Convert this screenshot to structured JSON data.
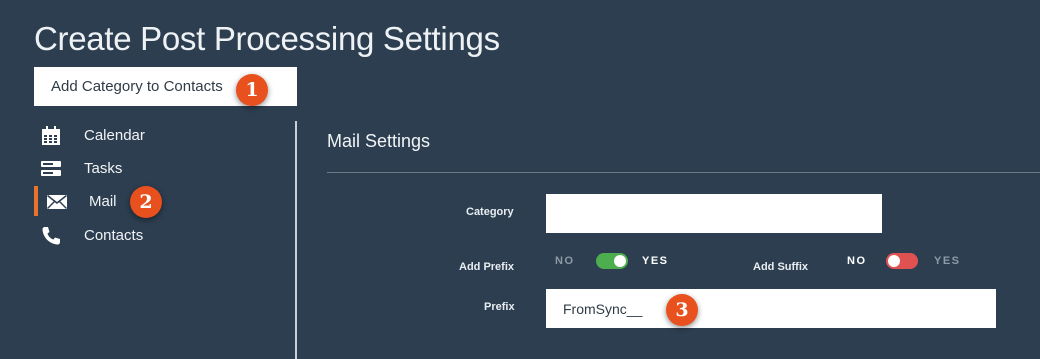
{
  "header": {
    "title": "Create Post Processing Settings"
  },
  "settings_name": {
    "value": "Add Category to Contacts",
    "marker": "1"
  },
  "sidebar": {
    "items": [
      {
        "label": "Calendar",
        "icon": "calendar-icon",
        "active": false
      },
      {
        "label": "Tasks",
        "icon": "tasks-icon",
        "active": false
      },
      {
        "label": "Mail",
        "icon": "mail-icon",
        "active": true,
        "marker": "2"
      },
      {
        "label": "Contacts",
        "icon": "phone-icon",
        "active": false
      }
    ]
  },
  "main": {
    "section_title": "Mail Settings",
    "category": {
      "label": "Category",
      "value": ""
    },
    "add_prefix": {
      "label": "Add Prefix",
      "off_text": "NO",
      "on_text": "YES",
      "enabled": true
    },
    "add_suffix": {
      "label": "Add Suffix",
      "off_text": "NO",
      "on_text": "YES",
      "enabled": false
    },
    "prefix": {
      "label": "Prefix",
      "value": "FromSync__",
      "marker": "3"
    }
  },
  "colors": {
    "background": "#2d3e50",
    "accent": "#e8742a",
    "marker": "#e8501e",
    "toggle_on": "#4cae4f",
    "toggle_off": "#e05252"
  }
}
